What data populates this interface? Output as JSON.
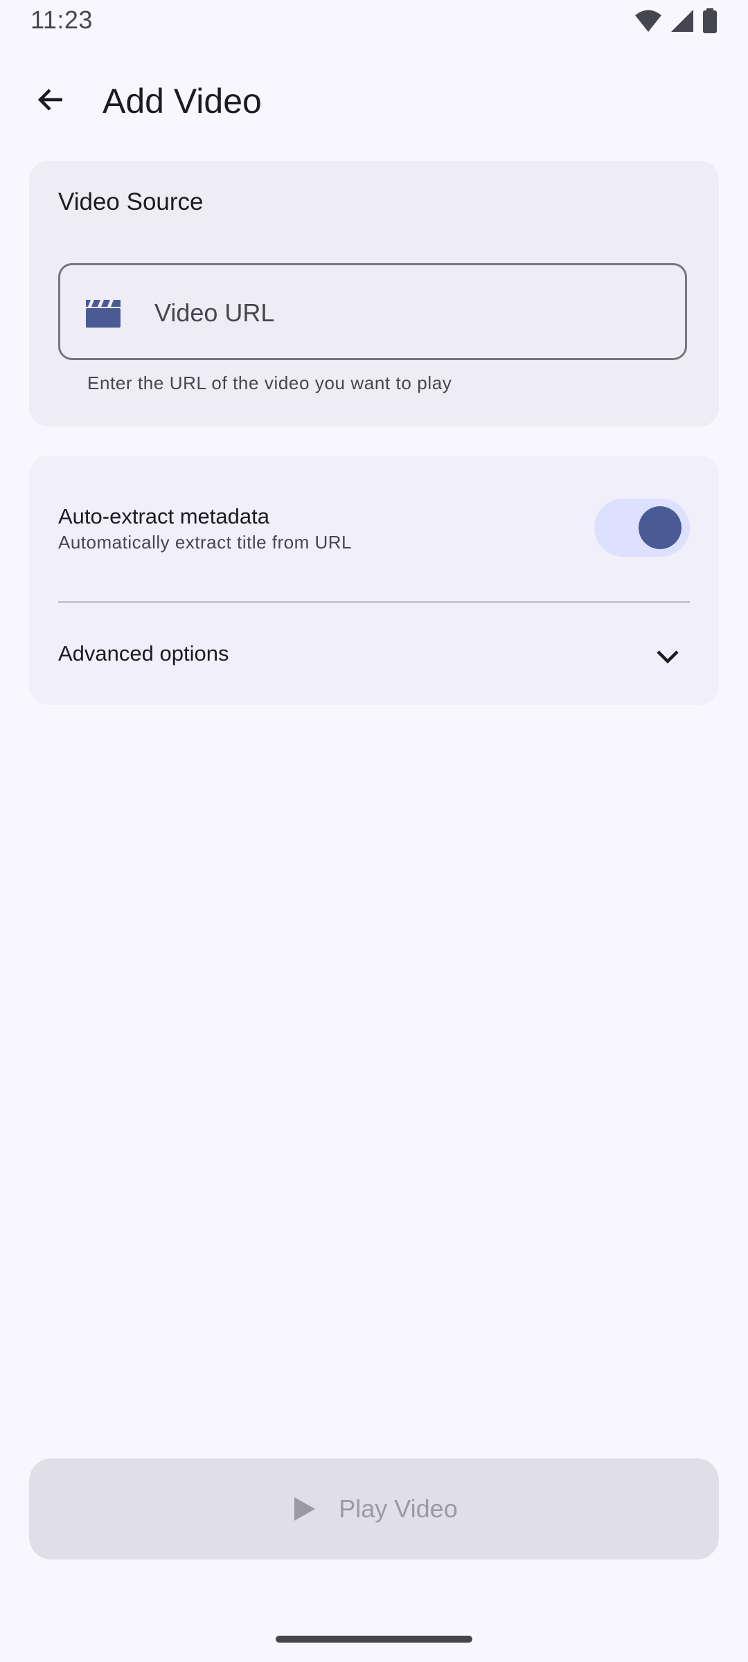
{
  "status_bar": {
    "time": "11:23",
    "icons": [
      "wifi-icon",
      "cell-signal-icon",
      "battery-icon"
    ]
  },
  "app_bar": {
    "back_icon": "arrow-back-icon",
    "title": "Add Video"
  },
  "video_source": {
    "title": "Video Source",
    "url_field": {
      "icon": "movie-clapper-icon",
      "placeholder": "Video URL",
      "value": "",
      "supporting_text": "Enter the URL of the video you want to play"
    }
  },
  "options": {
    "auto_extract": {
      "title": "Auto-extract metadata",
      "subtitle": "Automatically extract title from URL",
      "enabled": true
    },
    "advanced": {
      "label": "Advanced options",
      "icon": "chevron-down-icon"
    }
  },
  "play_button": {
    "label": "Play Video",
    "icon": "play-icon",
    "enabled": false
  },
  "colors": {
    "background": "#f8f7fd",
    "primary": "#4a5a95",
    "switch_track": "#dde1ff",
    "disabled_button": "#e0dfe6"
  }
}
